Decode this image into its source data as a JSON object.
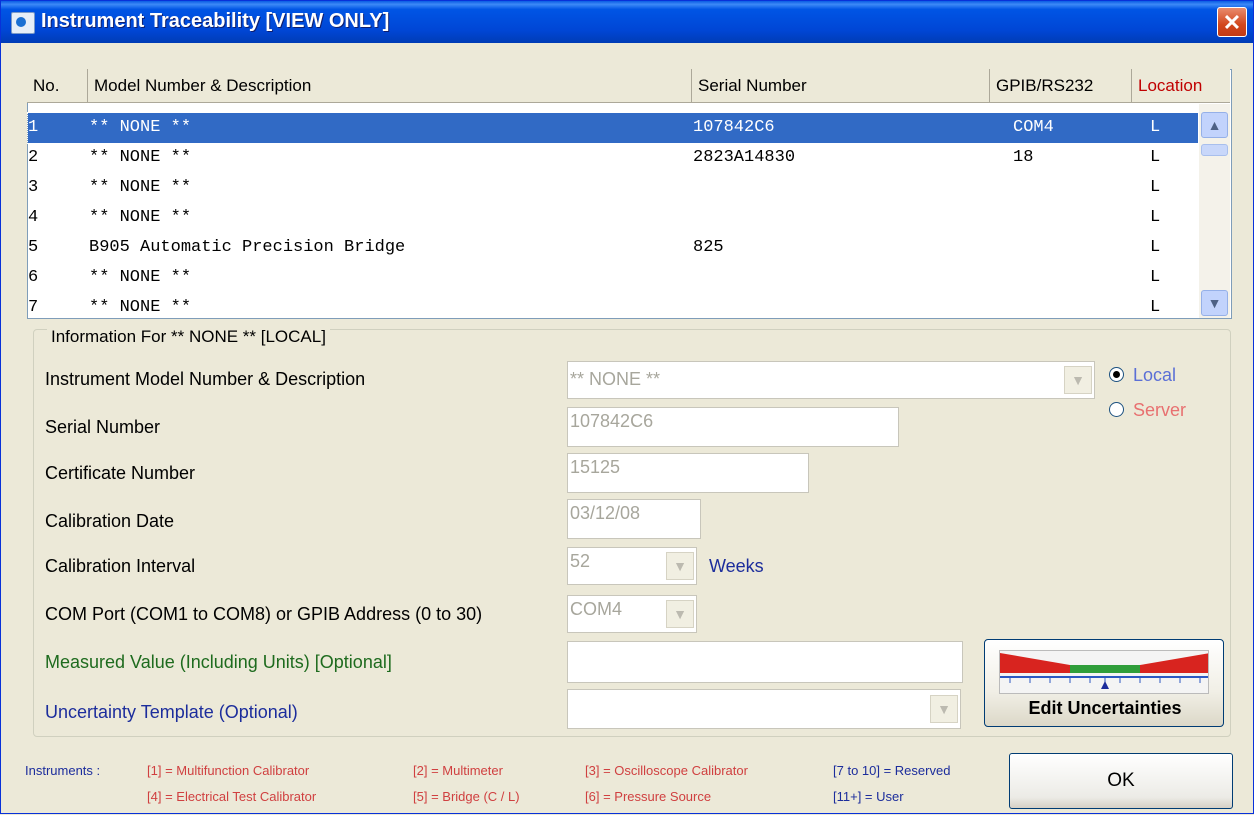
{
  "window": {
    "title": "Instrument Traceability [VIEW ONLY]",
    "close_glyph": "✕"
  },
  "grid": {
    "headers": {
      "no": "No.",
      "desc": "Model Number & Description",
      "serial": "Serial Number",
      "gpib": "GPIB/RS232",
      "location": "Location"
    },
    "rows": [
      {
        "no": "1",
        "desc": "** NONE **",
        "serial": "107842C6",
        "gpib": "COM4",
        "loc": "L"
      },
      {
        "no": "2",
        "desc": "** NONE **",
        "serial": "2823A14830",
        "gpib": "18",
        "loc": "L"
      },
      {
        "no": "3",
        "desc": "** NONE **",
        "serial": "",
        "gpib": "",
        "loc": "L"
      },
      {
        "no": "4",
        "desc": "** NONE **",
        "serial": "",
        "gpib": "",
        "loc": "L"
      },
      {
        "no": "5",
        "desc": "B905 Automatic Precision Bridge",
        "serial": "825",
        "gpib": "",
        "loc": "L"
      },
      {
        "no": "6",
        "desc": "** NONE **",
        "serial": "",
        "gpib": "",
        "loc": "L"
      },
      {
        "no": "7",
        "desc": "** NONE **",
        "serial": "",
        "gpib": "",
        "loc": "L"
      }
    ],
    "scroll_up": "▲",
    "scroll_down": "▼"
  },
  "info": {
    "legend": "Information For ** NONE ** [LOCAL]",
    "model_label": "Instrument Model Number & Description",
    "model_value": "** NONE **",
    "serial_label": "Serial Number",
    "serial_value": "107842C6",
    "cert_label": "Certificate Number",
    "cert_value": "15125",
    "cal_date_label": "Calibration Date",
    "cal_date_value": "03/12/08",
    "interval_label": "Calibration Interval",
    "interval_value": "52",
    "interval_units": "Weeks",
    "com_label": "COM Port (COM1 to COM8) or GPIB Address (0 to 30)",
    "com_value": "COM4",
    "measured_label": "Measured Value (Including Units) [Optional]",
    "measured_value": "",
    "template_label": "Uncertainty Template (Optional)",
    "template_value": "",
    "radio_local": "Local",
    "radio_server": "Server",
    "dropdown_glyph": "▼",
    "edit_uncertainties": "Edit Uncertainties"
  },
  "footer": {
    "instruments_label": "Instruments :",
    "items": [
      "[1] = Multifunction Calibrator",
      "[2] = Multimeter",
      "[3] = Oscilloscope Calibrator",
      "[7 to 10] = Reserved",
      "[4] = Electrical Test Calibrator",
      "[5] = Bridge (C / L)",
      "[6] = Pressure Source",
      "[11+] = User"
    ],
    "ok": "OK"
  },
  "colors": {
    "title_bar": "#0054e3",
    "selection": "#316ac5",
    "location_header": "#c00000",
    "local_radio": "#5b6fd6",
    "server_radio": "#e87070",
    "measured_label": "#1e6b1e",
    "template_label": "#1c2d9c",
    "weeks": "#1c2d9c",
    "footer_red": "#d04040",
    "footer_blue": "#1c2d9c"
  }
}
